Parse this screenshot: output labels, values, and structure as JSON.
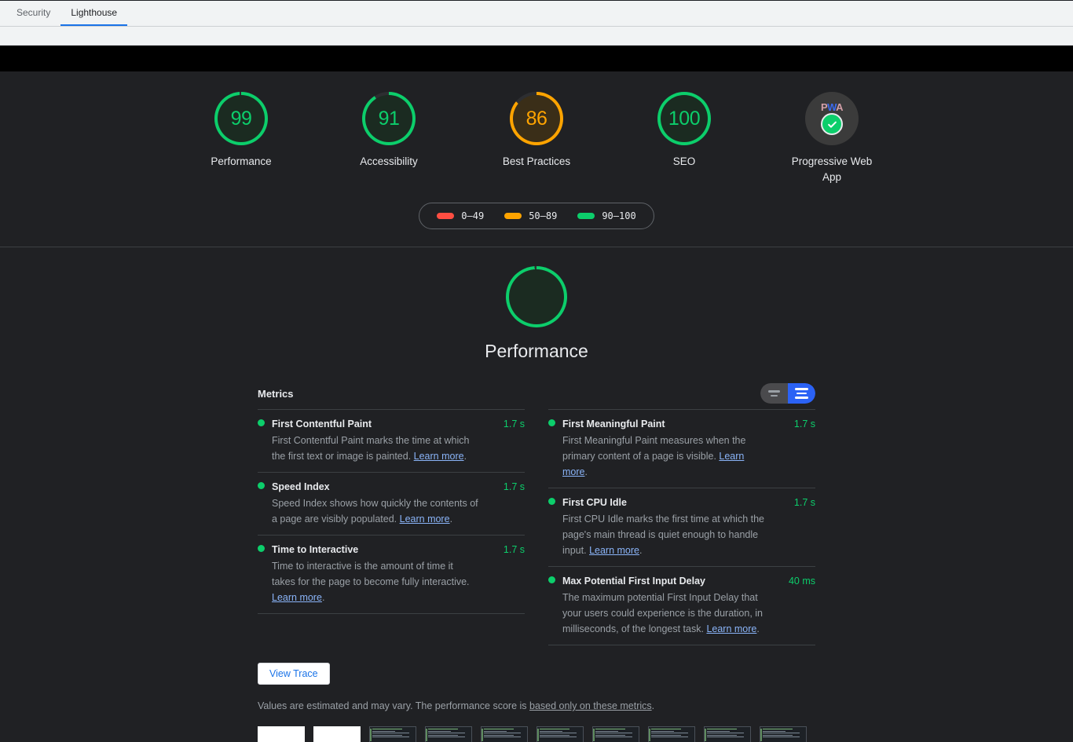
{
  "devtools": {
    "tabs": [
      {
        "label": "Security",
        "active": false
      },
      {
        "label": "Lighthouse",
        "active": true
      }
    ]
  },
  "report": {
    "scores": [
      {
        "score": "99",
        "label": "Performance",
        "color": "#0cce6b",
        "pct": 99
      },
      {
        "score": "91",
        "label": "Accessibility",
        "color": "#0cce6b",
        "pct": 91
      },
      {
        "score": "86",
        "label": "Best Practices",
        "color": "#ffa400",
        "pct": 86
      },
      {
        "score": "100",
        "label": "SEO",
        "color": "#0cce6b",
        "pct": 100
      },
      {
        "score": "",
        "label": "Progressive Web App",
        "color": "#0cce6b",
        "pct": 100,
        "badge": "pwa"
      }
    ],
    "legend": [
      {
        "range": "0–49",
        "color": "#ff4e42"
      },
      {
        "range": "50–89",
        "color": "#ffa400"
      },
      {
        "range": "90–100",
        "color": "#0cce6b"
      }
    ],
    "category": {
      "score": "99",
      "title": "Performance",
      "color": "#0cce6b",
      "pct": 99
    },
    "metrics_section": {
      "title": "Metrics",
      "toggle_collapsed_name": "collapsed-view-toggle",
      "toggle_expanded_name": "expanded-view-toggle"
    },
    "metrics_left": [
      {
        "name": "First Contentful Paint",
        "value": "1.7 s",
        "desc_before": "First Contentful Paint marks the time at which the first text or image is painted. ",
        "link": "Learn more",
        "desc_after": "."
      },
      {
        "name": "Speed Index",
        "value": "1.7 s",
        "desc_before": "Speed Index shows how quickly the contents of a page are visibly populated. ",
        "link": "Learn more",
        "desc_after": "."
      },
      {
        "name": "Time to Interactive",
        "value": "1.7 s",
        "desc_before": "Time to interactive is the amount of time it takes for the page to become fully interactive. ",
        "link": "Learn more",
        "desc_after": "."
      }
    ],
    "metrics_right": [
      {
        "name": "First Meaningful Paint",
        "value": "1.7 s",
        "desc_before": "First Meaningful Paint measures when the primary content of a page is visible. ",
        "link": "Learn more",
        "desc_after": "."
      },
      {
        "name": "First CPU Idle",
        "value": "1.7 s",
        "desc_before": "First CPU Idle marks the first time at which the page's main thread is quiet enough to handle input. ",
        "link": "Learn more",
        "desc_after": "."
      },
      {
        "name": "Max Potential First Input Delay",
        "value": "40 ms",
        "desc_before": "The maximum potential First Input Delay that your users could experience is the duration, in milliseconds, of the longest task. ",
        "link": "Learn more",
        "desc_after": "."
      }
    ],
    "view_trace_label": "View Trace",
    "disclaimer_before": "Values are estimated and may vary. The performance score is ",
    "disclaimer_link": "based only on these metrics",
    "disclaimer_after": ".",
    "filmstrip": [
      {
        "type": "blank"
      },
      {
        "type": "blank"
      },
      {
        "type": "shot"
      },
      {
        "type": "shot"
      },
      {
        "type": "shot"
      },
      {
        "type": "shot"
      },
      {
        "type": "shot"
      },
      {
        "type": "shot"
      },
      {
        "type": "shot"
      },
      {
        "type": "shot"
      }
    ]
  },
  "colors": {
    "pass": "#0cce6b",
    "average": "#ffa400",
    "fail": "#ff4e42",
    "accent_blue": "#2b62f5",
    "link_blue": "#8ab4f8",
    "background": "#202124"
  }
}
